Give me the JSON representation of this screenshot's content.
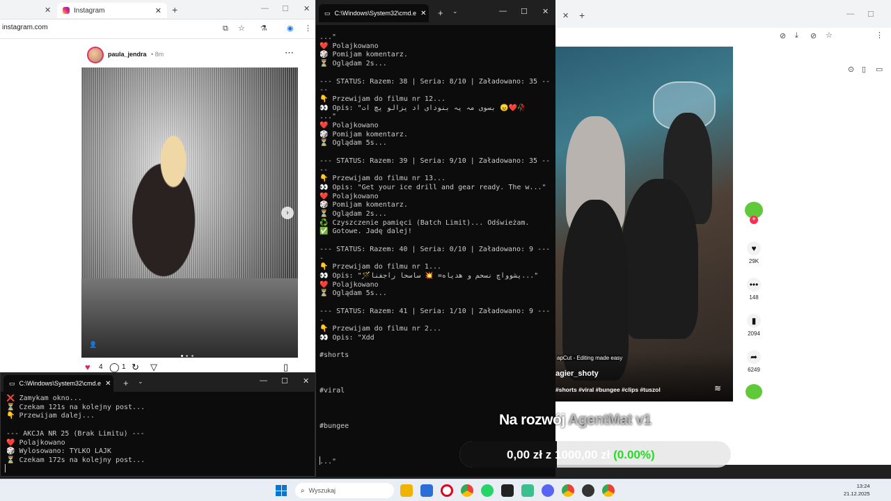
{
  "left_browser": {
    "tabs": [
      {
        "label": ""
      },
      {
        "label": "Instagram"
      }
    ],
    "url": "instagram.com",
    "post": {
      "username": "paula_jendra",
      "time": "• 8m",
      "likes": "4",
      "comments": "1"
    }
  },
  "cmd_main": {
    "tab_title": "C:\\Windows\\System32\\cmd.e",
    "lines": [
      "...\"",
      "❤️ Polajkowano",
      "🎲 Pomijam komentarz.",
      "⏳ Oglądam 2s...",
      "",
      "--- STATUS: Razem: 38 | Seria: 8/10 | Załadowano: 35 --",
      "--",
      "👇 Przewijam do filmu nr 12...",
      "👀 Opis: \"بسوی مہ یہ بنودای اد یزالو یچ ات 😠❤️🥀",
      "...\"",
      "❤️ Polajkowano",
      "🎲 Pomijam komentarz.",
      "⏳ Oglądam 5s...",
      "",
      "--- STATUS: Razem: 39 | Seria: 9/10 | Załadowano: 35 --",
      "--",
      "👇 Przewijam do filmu nr 13...",
      "👀 Opis: \"Get your ice drill and gear ready. The w...\"",
      "❤️ Polajkowano",
      "🎲 Pomijam komentarz.",
      "⏳ Oglądam 2s...",
      "♻️ Czyszczenie pamięci (Batch Limit)... Odświeżam.",
      "✅ Gotowe. Jadę dalej!",
      "",
      "--- STATUS: Razem: 40 | Seria: 0/10 | Załadowano: 9 ---",
      "-",
      "👇 Przewijam do filmu nr 1...",
      "👀 Opis: \"🪄یشوواچ نسحم و هدیاه= 💥 ساسحا راجفنا...\"",
      "❤️ Polajkowano",
      "⏳ Oglądam 5s...",
      "",
      "--- STATUS: Razem: 41 | Seria: 1/10 | Załadowano: 9 ---",
      "-",
      "👇 Przewijam do filmu nr 2...",
      "👀 Opis: \"Xdd",
      "",
      "#shorts",
      "",
      "",
      "",
      "#viral",
      "",
      "",
      "",
      "#bungee",
      "",
      "",
      "",
      "...\""
    ]
  },
  "cmd_small": {
    "tab_title": "C:\\Windows\\System32\\cmd.e",
    "lines": [
      "❌ Zamykam okno...",
      "⏳ Czekam 121s na kolejny post...",
      "👇 Przewijam dalej...",
      "",
      "--- AKCJA NR 25 (Brak Limitu) ---",
      "❤️ Polajkowano",
      "🎲 Wylosowano: TYLKO LAJK",
      "⏳ Czekam 172s na kolejny post..."
    ]
  },
  "right_browser": {
    "video": {
      "caption_brand": "apCut - Editing made easy",
      "caption_user": "agier_shoty",
      "caption_tags": "#shorts #viral #bungee #clips #tuszol"
    },
    "side": {
      "likes": "29K",
      "comments": "148",
      "saves": "2094",
      "shares": "6249"
    }
  },
  "overlay": {
    "title_main": "Na rozwój ",
    "title_faded": "AgentMat v1",
    "amount_current": "0,00 zł",
    "amount_sep": " z ",
    "amount_goal": "1000,00 zł",
    "amount_pct": " (0.00%)"
  },
  "taskbar": {
    "search_placeholder": "Wyszukaj",
    "time": "13:24",
    "date": "21.12.2025"
  }
}
